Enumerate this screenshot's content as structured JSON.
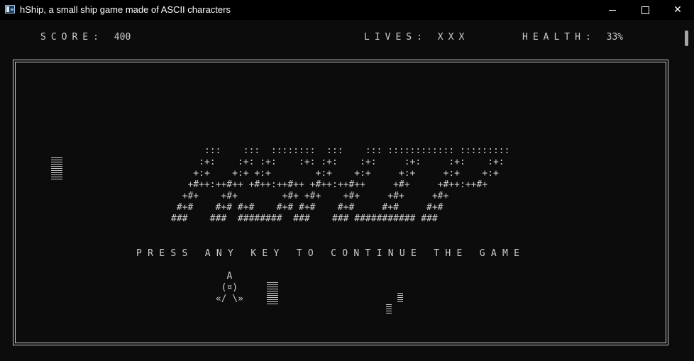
{
  "window": {
    "title": "hShip, a small ship game made of ASCII characters",
    "icons": {
      "app": "console-app-icon",
      "minimize": "minimize-icon",
      "maximize": "maximize-icon",
      "close": "close-icon"
    }
  },
  "hud": {
    "score_label": "SCORE: ",
    "score_value": "400",
    "lives_label": "LIVES: ",
    "lives_value": "XXX",
    "health_label": "HEALTH: ",
    "health_value": "33%"
  },
  "game": {
    "logo_ascii": "      :::    :::  ::::::::  :::    ::: :::::::::::: ::::::::: \n     :+:    :+: :+:    :+: :+:    :+:     :+:     :+:    :+: \n    +:+    +:+ +:+        +:+    +:+     +:+     +:+    +:+  \n   +#++:++#++ +#++:++#++ +#++:++#++     +#+     +#++:++#+    \n  +#+    +#+        +#+ +#+    +#+     +#+     +#+           \n #+#    #+# #+#    #+# #+#    #+#     #+#     #+#            \n###    ###  ########  ###    ### ########### ###             ",
    "prompt": "PRESS ANY KEY TO CONTINUE THE GAME",
    "ship_ascii": "   A\n  (¤)\n «/ \\»",
    "colors": {
      "background": "#0c0c0c",
      "foreground": "#cccccc"
    }
  }
}
